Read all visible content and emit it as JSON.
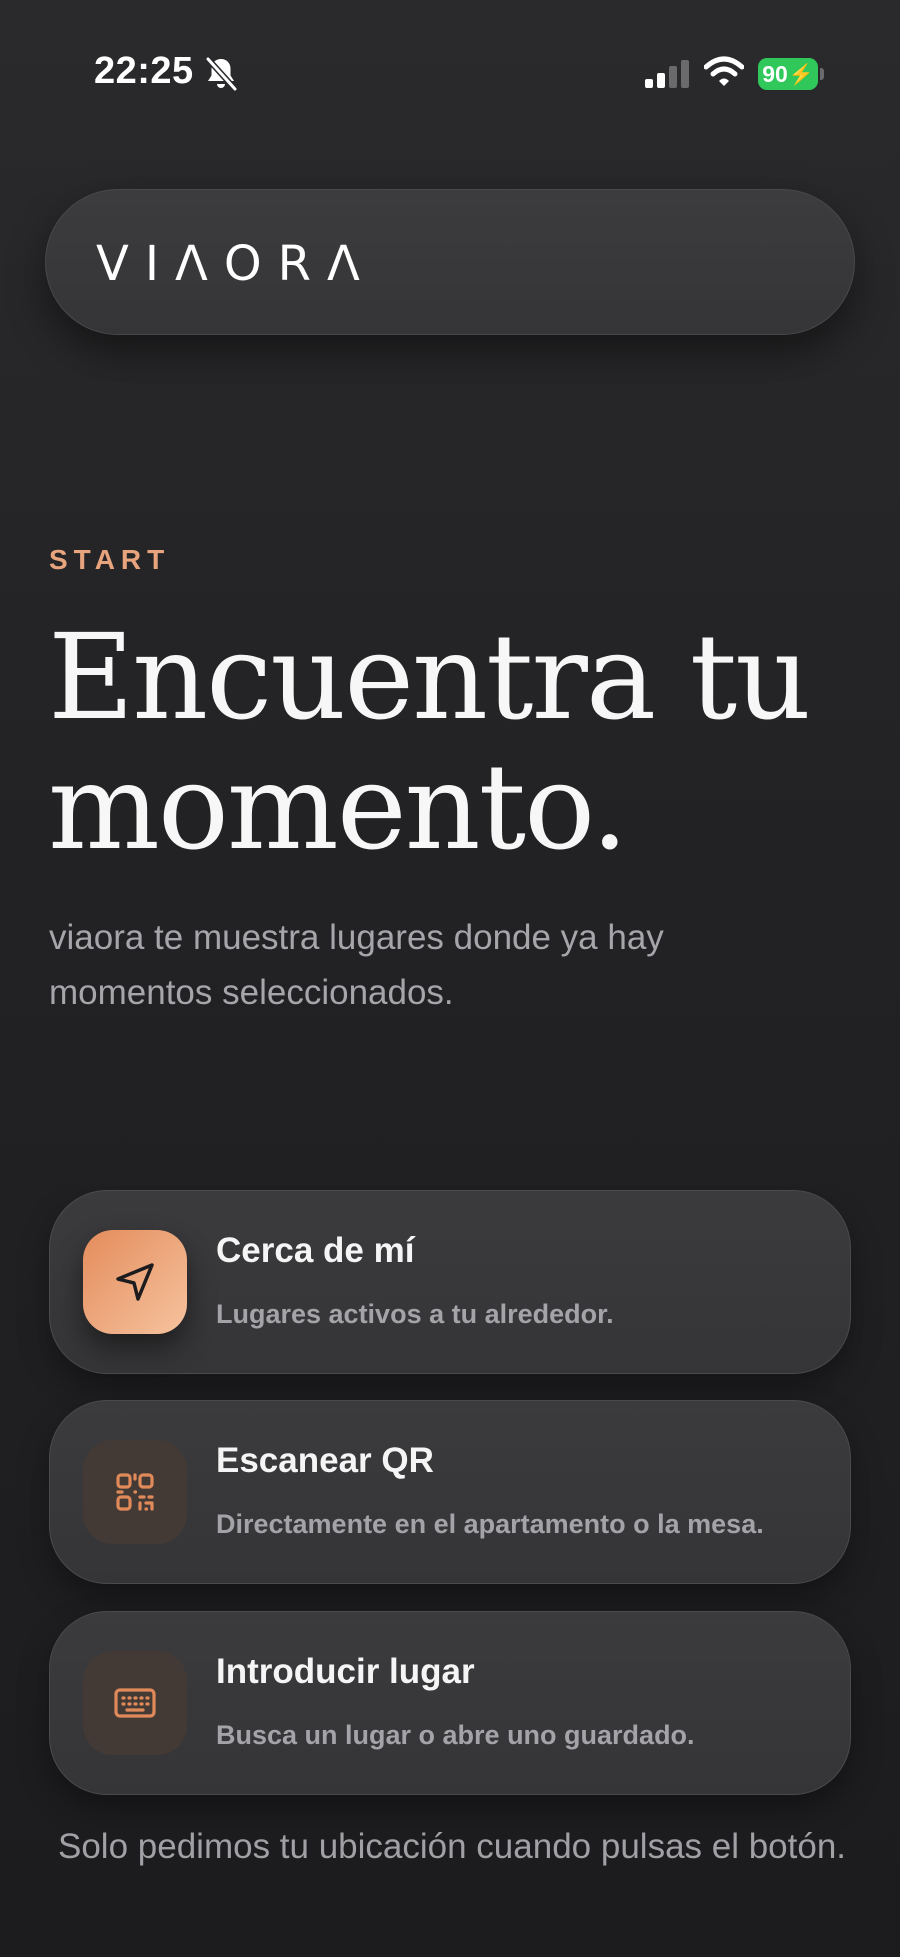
{
  "status_bar": {
    "time": "22:25",
    "battery": "90",
    "icons": [
      "bell-slash-icon",
      "cellular-signal-icon",
      "wifi-icon",
      "battery-charging-icon"
    ]
  },
  "header": {
    "logo": "VIΛORΛ"
  },
  "hero": {
    "eyebrow": "START",
    "headline_line1": "Encuentra tu",
    "headline_line2": "momento.",
    "subtitle": "viaora te muestra lugares donde ya hay momentos seleccionados."
  },
  "options": [
    {
      "title": "Cerca de mí",
      "description": "Lugares activos a tu alrededor.",
      "icon": "location-arrow-icon"
    },
    {
      "title": "Escanear QR",
      "description": "Directamente en el apartamento o la mesa.",
      "icon": "qr-code-icon"
    },
    {
      "title": "Introducir lugar",
      "description": "Busca un lugar o abre uno guardado.",
      "icon": "keyboard-icon"
    }
  ],
  "footnote": "Solo pedimos tu ubicación cuando pulsas el botón.",
  "colors": {
    "accent": "#e8a47d",
    "accent_gradient_start": "#e48c5c",
    "accent_gradient_end": "#f6c39e",
    "background": "#232325",
    "card": "#39393b",
    "battery": "#30c85a"
  }
}
